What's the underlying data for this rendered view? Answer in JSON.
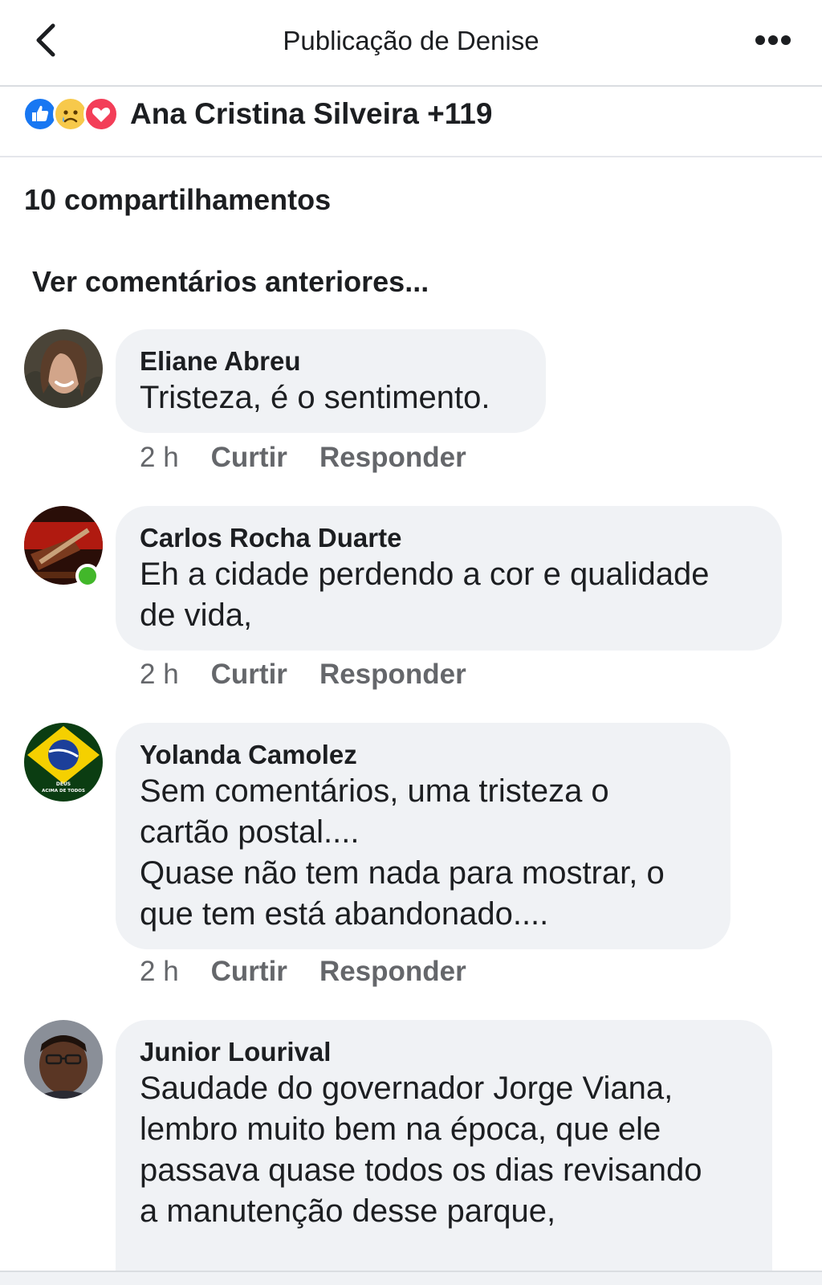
{
  "header": {
    "title": "Publicação de Denise"
  },
  "reactions": {
    "icons": [
      "like-icon",
      "sad-icon",
      "love-icon"
    ],
    "summary": "Ana Cristina Silveira +119"
  },
  "shares": "10 compartilhamentos",
  "previous_comments_link": "Ver comentários anteriores...",
  "comments": [
    {
      "author": "Eliane Abreu",
      "text": "Tristeza, é o sentimento.",
      "time": "2 h",
      "like_label": "Curtir",
      "reply_label": "Responder"
    },
    {
      "author": "Carlos Rocha Duarte",
      "text": "Eh a cidade perdendo a cor e qualidade\nde vida,",
      "time": "2 h",
      "like_label": "Curtir",
      "reply_label": "Responder"
    },
    {
      "author": "Yolanda Camolez",
      "text": "Sem comentários, uma tristeza o\ncartão postal....\nQuase não tem nada para mostrar, o\nque tem está abandonado....",
      "time": "2 h",
      "like_label": "Curtir",
      "reply_label": "Responder",
      "avatar_caption": [
        "DEUS",
        "ACIMA DE TODOS"
      ]
    },
    {
      "author": "Junior Lourival",
      "text": "Saudade do governador Jorge Viana,\nlembro muito bem na época, que ele\npassava quase todos os dias revisando\na manutenção desse parque,"
    }
  ],
  "colors": {
    "like": "#1877f2",
    "love": "#f33e58",
    "sad": "#f7c94b",
    "bubble": "#f0f2f5",
    "meta_text": "#65676b",
    "online": "#42b72a"
  }
}
